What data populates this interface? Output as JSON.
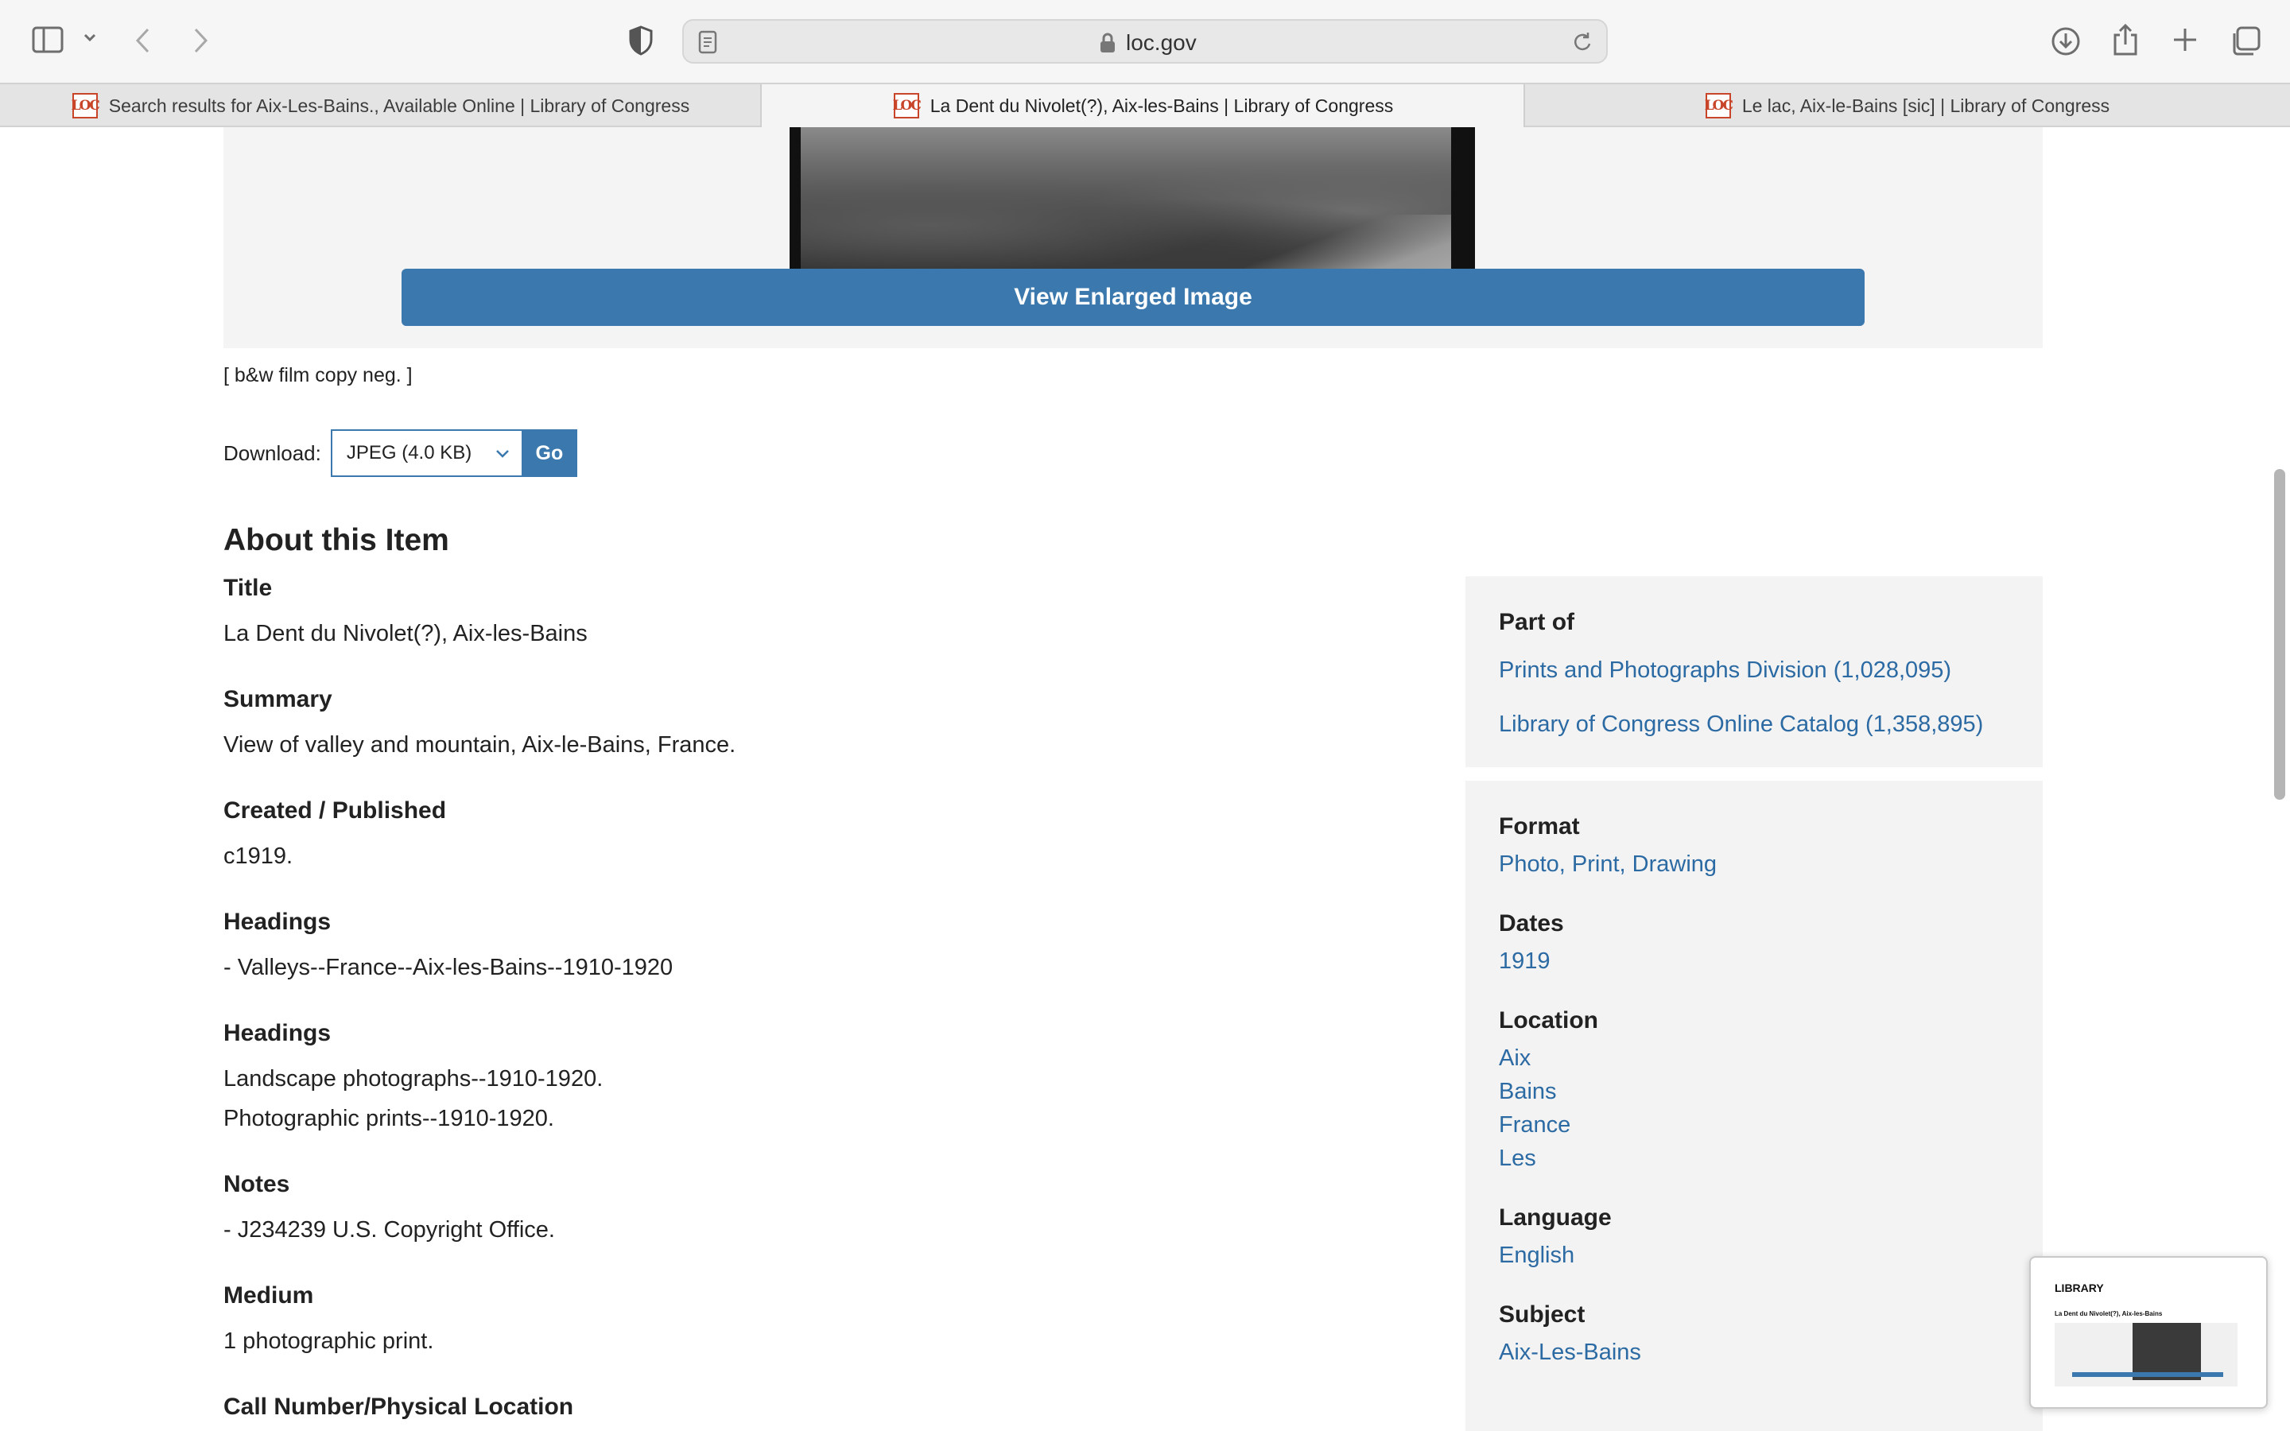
{
  "browser": {
    "url": "loc.gov",
    "tabs": [
      {
        "label": "Search results for Aix-Les-Bains., Available Online | Library of Congress",
        "favicon": "LOC"
      },
      {
        "label": "La Dent du Nivolet(?), Aix-les-Bains | Library of Congress",
        "favicon": "LOC"
      },
      {
        "label": "Le lac, Aix-le-Bains [sic] | Library of Congress",
        "favicon": "LOC"
      }
    ],
    "active_tab": 1
  },
  "image_panel": {
    "enlarge_label": "View Enlarged Image",
    "caption": "[ b&w film copy neg. ]"
  },
  "download": {
    "label": "Download:",
    "selected": "JPEG (4.0 KB)",
    "go_label": "Go"
  },
  "about": {
    "heading": "About this Item",
    "fields": [
      {
        "label": "Title",
        "values": [
          "La Dent du Nivolet(?), Aix-les-Bains"
        ]
      },
      {
        "label": "Summary",
        "values": [
          "View of valley and mountain, Aix-le-Bains, France."
        ]
      },
      {
        "label": "Created / Published",
        "values": [
          "c1919."
        ]
      },
      {
        "label": "Headings",
        "values": [
          "-  Valleys--France--Aix-les-Bains--1910-1920"
        ]
      },
      {
        "label": "Headings",
        "values": [
          "Landscape photographs--1910-1920.",
          "Photographic prints--1910-1920."
        ]
      },
      {
        "label": "Notes",
        "values": [
          "-  J234239 U.S. Copyright Office."
        ]
      },
      {
        "label": "Medium",
        "values": [
          "1 photographic print."
        ]
      },
      {
        "label": "Call Number/Physical Location",
        "values": []
      }
    ]
  },
  "part_of": {
    "label": "Part of",
    "links": [
      "Prints and Photographs Division (1,028,095)",
      "Library of Congress Online Catalog (1,358,895)"
    ]
  },
  "meta": [
    {
      "label": "Format",
      "values": [
        "Photo, Print, Drawing"
      ]
    },
    {
      "label": "Dates",
      "values": [
        "1919"
      ]
    },
    {
      "label": "Location",
      "values": [
        "Aix",
        "Bains",
        "France",
        "Les"
      ]
    },
    {
      "label": "Language",
      "values": [
        "English"
      ]
    },
    {
      "label": "Subject",
      "values": [
        "Aix-Les-Bains"
      ]
    }
  ],
  "thumbnail": {
    "logo": "LIBRARY",
    "title": "La Dent du Nivolet(?), Aix-les-Bains"
  },
  "colors": {
    "accent": "#3b78ad",
    "link": "#2b6aa3",
    "panel": "#f3f3f3"
  }
}
